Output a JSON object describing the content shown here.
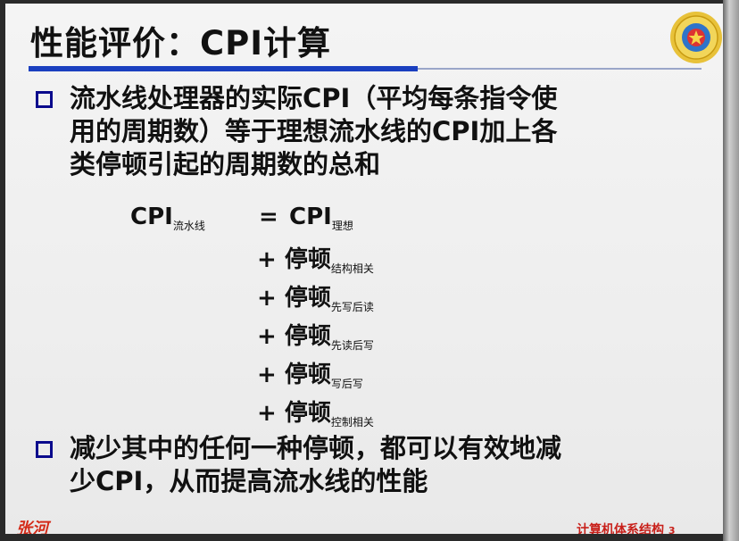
{
  "slide": {
    "title": "性能评价：CPI计算",
    "bullet1": {
      "lines": [
        "流水线处理器的实际CPI（平均每条指令使",
        "用的周期数）等于理想流水线的CPI加上各",
        "类停顿引起的周期数的总和"
      ]
    },
    "formula": {
      "lhs": "CPI",
      "lhs_sub": "流水线",
      "eq": "=",
      "rhs": "CPI",
      "rhs_sub": "理想",
      "terms": [
        {
          "op": "+",
          "label": "停顿",
          "sub": "结构相关"
        },
        {
          "op": "+",
          "label": "停顿",
          "sub": "先写后读"
        },
        {
          "op": "+",
          "label": "停顿",
          "sub": "先读后写"
        },
        {
          "op": "+",
          "label": "停顿",
          "sub": "写后写"
        },
        {
          "op": "+",
          "label": "停顿",
          "sub": "控制相关"
        }
      ]
    },
    "bullet2": {
      "lines": [
        "减少其中的任何一种停顿，都可以有效地减",
        "少CPI，从而提高流水线的性能"
      ]
    },
    "footer": {
      "signature": "张河",
      "course": "计算机体系结构",
      "page": "3"
    }
  },
  "colors": {
    "title_rule": "#1a3fbf",
    "bullet": "#0a0a8c",
    "footer": "#c8201a"
  }
}
